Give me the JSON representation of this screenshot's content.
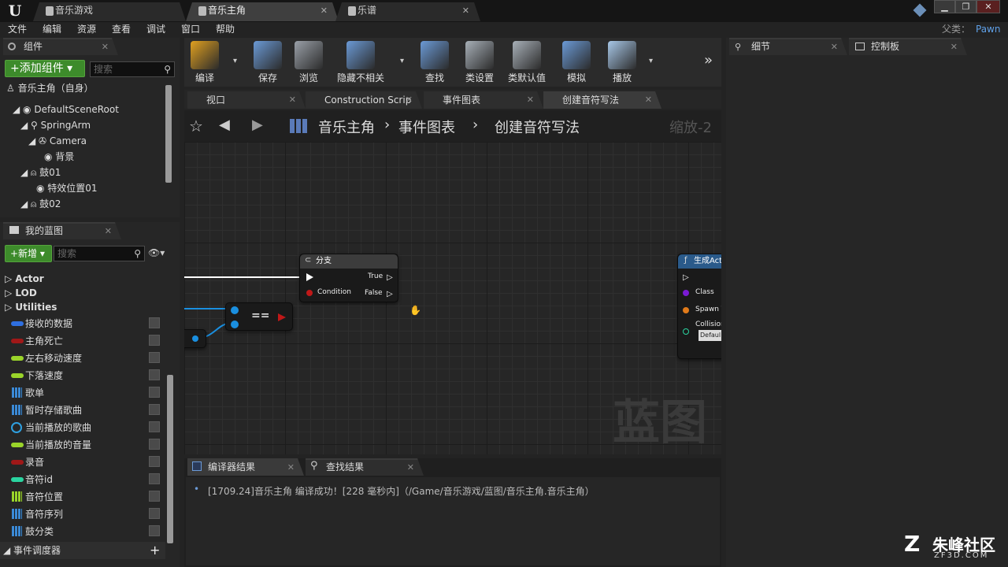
{
  "window": {
    "tabs": [
      {
        "label": "音乐游戏"
      },
      {
        "label": "音乐主角"
      },
      {
        "label": "乐谱"
      }
    ],
    "parent_label": "父类：",
    "parent_value": "Pawn"
  },
  "menubar": [
    "文件",
    "编辑",
    "资源",
    "查看",
    "调试",
    "窗口",
    "帮助"
  ],
  "components": {
    "tab": "组件",
    "add_button": "+添加组件",
    "search_placeholder": "搜索",
    "self": "音乐主角（自身）",
    "tree": [
      "DefaultSceneRoot",
      "SpringArm",
      "Camera",
      "背景",
      "鼓01",
      "特效位置01",
      "鼓02"
    ]
  },
  "my_blueprint": {
    "tab": "我的蓝图",
    "new_button": "+新增",
    "search_placeholder": "搜索",
    "categories": [
      "Actor",
      "LOD",
      "Utilities"
    ],
    "variables": [
      {
        "label": "接收的数据",
        "color": "#2f6fe0",
        "kind": "pill"
      },
      {
        "label": "主角死亡",
        "color": "#a01818",
        "kind": "pill"
      },
      {
        "label": "左右移动速度",
        "color": "#9ad42a",
        "kind": "pill"
      },
      {
        "label": "下落速度",
        "color": "#9ad42a",
        "kind": "pill"
      },
      {
        "label": "歌单",
        "color": "#3b8ad6",
        "kind": "grid"
      },
      {
        "label": "暂时存储歌曲",
        "color": "#3b8ad6",
        "kind": "grid"
      },
      {
        "label": "当前播放的歌曲",
        "color": "#2fa0e0",
        "kind": "ring"
      },
      {
        "label": "当前播放的音量",
        "color": "#9ad42a",
        "kind": "pill"
      },
      {
        "label": "录音",
        "color": "#a01818",
        "kind": "pill"
      },
      {
        "label": "音符id",
        "color": "#2ad4a0",
        "kind": "pill"
      },
      {
        "label": "音符位置",
        "color": "#9ad42a",
        "kind": "grid"
      },
      {
        "label": "音符序列",
        "color": "#3b8ad6",
        "kind": "grid"
      },
      {
        "label": "鼓分类",
        "color": "#3b8ad6",
        "kind": "grid"
      }
    ],
    "dispatchers": "事件调度器"
  },
  "toolbar": [
    {
      "label": "编译",
      "icon": "compile-icon",
      "color": "#e0a020"
    },
    {
      "label": "保存",
      "icon": "save-icon",
      "color": "#6b9ad6"
    },
    {
      "label": "浏览",
      "icon": "browse-icon",
      "color": "#9aa0a8"
    },
    {
      "label": "隐藏不相关",
      "icon": "hide-unrelated-icon",
      "color": "#6b9ad6"
    },
    {
      "label": "查找",
      "icon": "find-icon",
      "color": "#6b9ad6"
    },
    {
      "label": "类设置",
      "icon": "class-settings-icon",
      "color": "#a8b0b8"
    },
    {
      "label": "类默认值",
      "icon": "class-defaults-icon",
      "color": "#a8b0b8"
    },
    {
      "label": "模拟",
      "icon": "simulate-icon",
      "color": "#6b9ad6"
    },
    {
      "label": "播放",
      "icon": "play-icon",
      "color": "#a8c8e8"
    }
  ],
  "graph_tabs": [
    {
      "label": "视口"
    },
    {
      "label": "Construction Scrip"
    },
    {
      "label": "事件图表"
    },
    {
      "label": "创建音符写法"
    }
  ],
  "breadcrumb": {
    "root": "音乐主角",
    "graph": "事件图表",
    "function": "创建音符写法",
    "zoom": "缩放-2"
  },
  "nodes": {
    "branch": {
      "title": "分支",
      "true": "True",
      "false": "False",
      "condition": "Condition"
    },
    "equals": {
      "title": "=="
    },
    "spawn": {
      "title": "生成Act",
      "class": "Class",
      "spawn": "Spawn T",
      "collision": "Collision",
      "default": "Defaul"
    }
  },
  "watermark": "蓝图",
  "details": {
    "tab": "细节"
  },
  "palette": {
    "tab": "控制板"
  },
  "output": {
    "tabs": [
      "编译器结果",
      "查找结果"
    ],
    "message": "[1709.24]音乐主角 编译成功！[228 毫秒内]（/Game/音乐游戏/蓝图/音乐主角.音乐主角）"
  },
  "branding": {
    "logo_text": "朱峰社区",
    "logo_url_text": "ZF3D.COM"
  }
}
